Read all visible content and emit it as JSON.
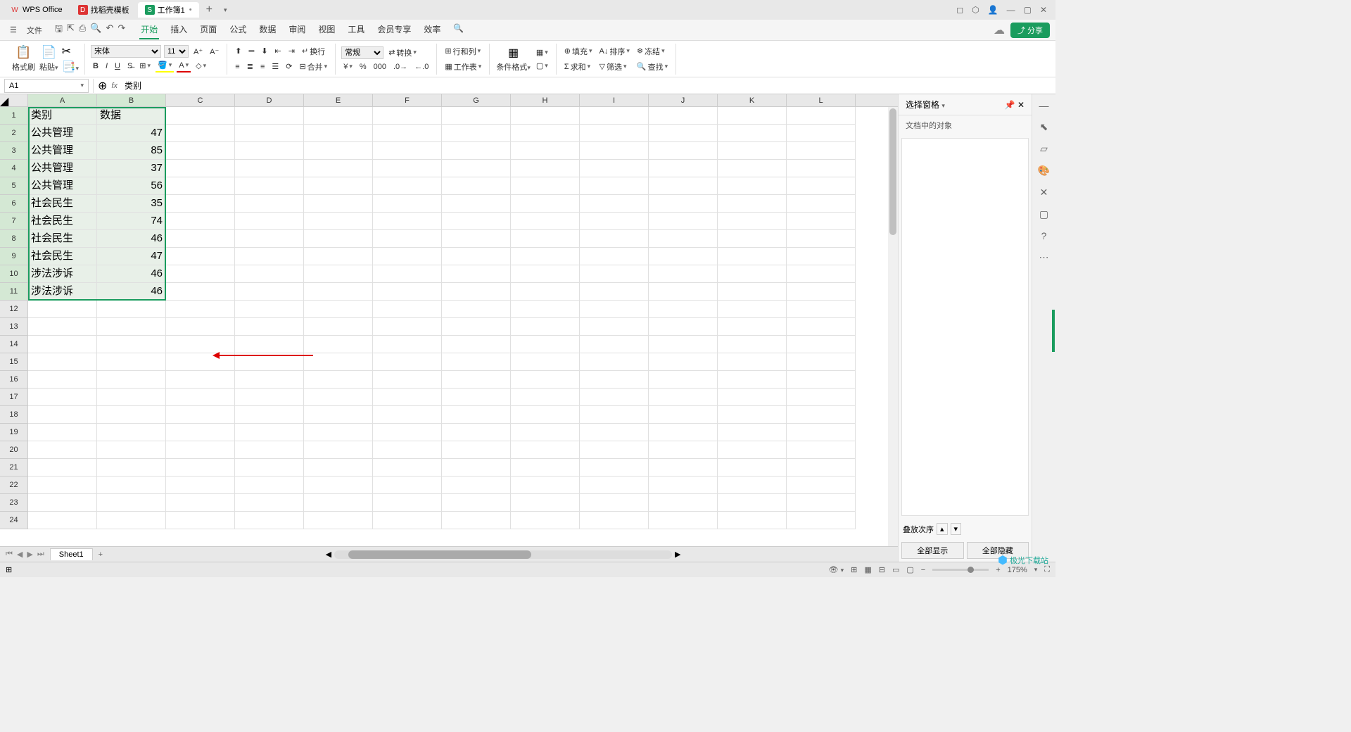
{
  "titlebar": {
    "app": "WPS Office",
    "tab_template": "找稻壳模板",
    "tab_workbook": "工作簿1"
  },
  "menu": {
    "file": "文件"
  },
  "ribbon_tabs": {
    "start": "开始",
    "insert": "插入",
    "page": "页面",
    "formula": "公式",
    "data": "数据",
    "review": "审阅",
    "view": "视图",
    "tools": "工具",
    "member": "会员专享",
    "efficiency": "效率"
  },
  "ribbon": {
    "format_painter": "格式刷",
    "paste": "粘贴",
    "font_name": "宋体",
    "font_size": "11",
    "wrap": "换行",
    "merge": "合并",
    "general": "常规",
    "convert": "转换",
    "row_col": "行和列",
    "worksheet": "工作表",
    "cond_format": "条件格式",
    "fill": "填充",
    "sort": "排序",
    "freeze": "冻结",
    "sum": "求和",
    "filter": "筛选",
    "find": "查找"
  },
  "share": "分享",
  "namebox": "A1",
  "formula": "类别",
  "columns": [
    "A",
    "B",
    "C",
    "D",
    "E",
    "F",
    "G",
    "H",
    "I",
    "J",
    "K",
    "L"
  ],
  "rows": [
    "1",
    "2",
    "3",
    "4",
    "5",
    "6",
    "7",
    "8",
    "9",
    "10",
    "11",
    "12",
    "13",
    "14",
    "15",
    "16",
    "17",
    "18",
    "19",
    "20",
    "21",
    "22",
    "23",
    "24"
  ],
  "data": {
    "header": [
      "类别",
      "数据"
    ],
    "cells": [
      [
        "公共管理",
        "47"
      ],
      [
        "公共管理",
        "85"
      ],
      [
        "公共管理",
        "37"
      ],
      [
        "公共管理",
        "56"
      ],
      [
        "社会民生",
        "35"
      ],
      [
        "社会民生",
        "74"
      ],
      [
        "社会民生",
        "46"
      ],
      [
        "社会民生",
        "47"
      ],
      [
        "涉法涉诉",
        "46"
      ],
      [
        "涉法涉诉",
        "46"
      ]
    ]
  },
  "panel": {
    "title": "选择窗格",
    "subtitle": "文档中的对象",
    "stack": "叠放次序",
    "show_all": "全部显示",
    "hide_all": "全部隐藏"
  },
  "sheet": "Sheet1",
  "zoom": "175%",
  "watermark": "极光下载站"
}
